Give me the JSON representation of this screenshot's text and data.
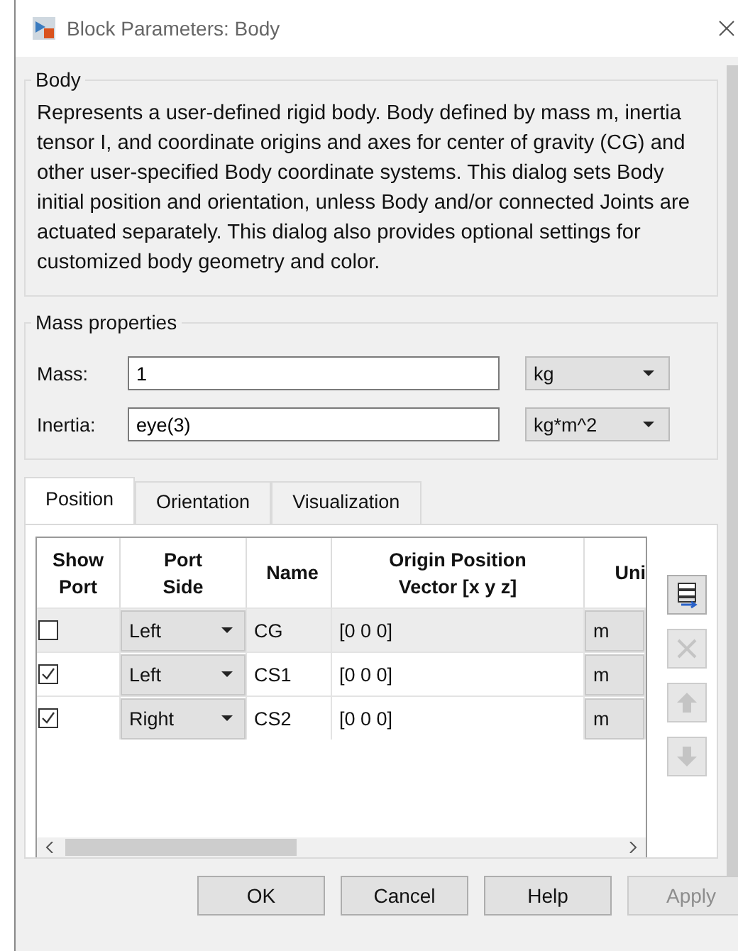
{
  "window": {
    "title": "Block Parameters: Body"
  },
  "body_group": {
    "title": "Body",
    "description": "Represents a user-defined rigid body. Body defined by mass m, inertia tensor I, and coordinate origins and axes for center of gravity (CG) and other user-specified Body coordinate systems. This dialog sets Body initial position and orientation, unless Body and/or connected Joints are actuated separately. This dialog also provides optional settings for customized body geometry and color."
  },
  "mass_properties": {
    "title": "Mass properties",
    "fields": [
      {
        "label": "Mass:",
        "value": "1",
        "unit": "kg"
      },
      {
        "label": "Inertia:",
        "value": "eye(3)",
        "unit": "kg*m^2"
      }
    ]
  },
  "tabs": [
    {
      "label": "Position",
      "selected": true
    },
    {
      "label": "Orientation",
      "selected": false
    },
    {
      "label": "Visualization",
      "selected": false
    }
  ],
  "table": {
    "columns": [
      "Show Port",
      "Port Side",
      "Name",
      "Origin Position Vector [x y z]",
      "Uni"
    ],
    "rows": [
      {
        "show_port": false,
        "port_side": "Left",
        "name": "CG",
        "origin": "[0 0 0]",
        "unit": "m",
        "selected": true
      },
      {
        "show_port": true,
        "port_side": "Left",
        "name": "CS1",
        "origin": "[0 0 0]",
        "unit": "m",
        "selected": false
      },
      {
        "show_port": true,
        "port_side": "Right",
        "name": "CS2",
        "origin": "[0 0 0]",
        "unit": "m",
        "selected": false
      }
    ]
  },
  "side_buttons": [
    {
      "kind": "add",
      "disabled": false
    },
    {
      "kind": "delete",
      "disabled": true
    },
    {
      "kind": "up",
      "disabled": true
    },
    {
      "kind": "down",
      "disabled": true
    }
  ],
  "buttons": [
    {
      "label": "OK",
      "disabled": false
    },
    {
      "label": "Cancel",
      "disabled": false
    },
    {
      "label": "Help",
      "disabled": false
    },
    {
      "label": "Apply",
      "disabled": true
    }
  ]
}
